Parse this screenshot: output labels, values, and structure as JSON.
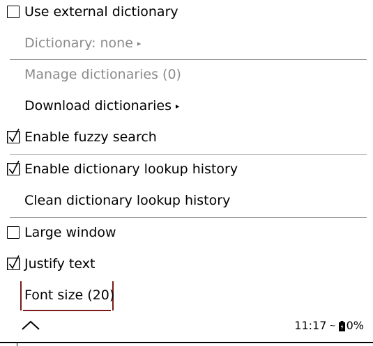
{
  "menu": {
    "items": [
      {
        "label": "Use external dictionary",
        "checked": false
      },
      {
        "label": "Dictionary: none",
        "disabled": true,
        "submenu": true
      },
      {
        "label": "Manage dictionaries (0)",
        "disabled": true
      },
      {
        "label": "Download dictionaries",
        "submenu": true
      },
      {
        "label": "Enable fuzzy search",
        "checked": true
      },
      {
        "label": "Enable dictionary lookup history",
        "checked": true
      },
      {
        "label": "Clean dictionary lookup history"
      },
      {
        "label": "Large window",
        "checked": false
      },
      {
        "label": "Justify text",
        "checked": true
      },
      {
        "label": "Font size (20)",
        "focused": true
      }
    ],
    "submenu_arrow": "▸"
  },
  "footer": {
    "up_icon": "chevron-up-icon",
    "time": "11:17",
    "wifi_glyph": "~",
    "battery_icon": "battery-charging-icon",
    "battery": "0%"
  },
  "colors": {
    "disabled_text": "#8a8a8a",
    "focus_border": "#7a1a1a",
    "divider": "#9a9a9a"
  }
}
